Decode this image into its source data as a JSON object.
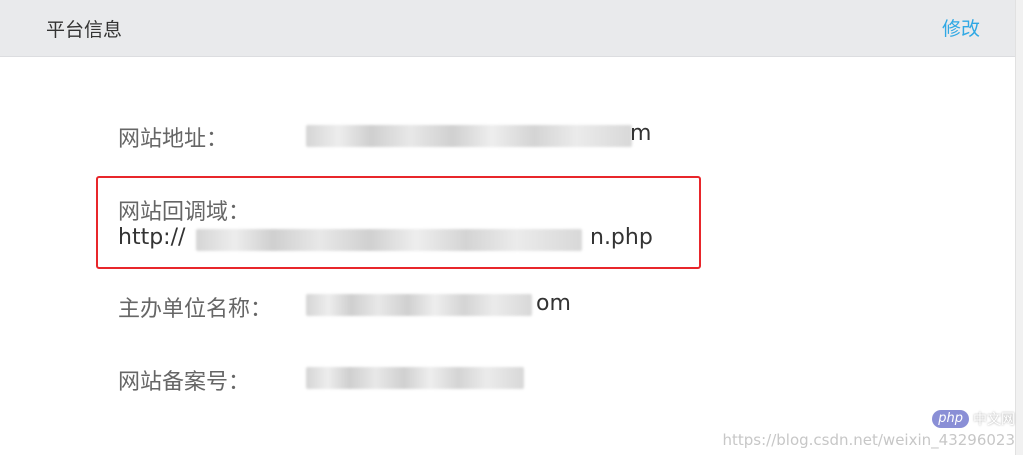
{
  "header": {
    "title": "平台信息",
    "edit_label": "修改"
  },
  "fields": {
    "site_address": {
      "label": "网站地址：",
      "value_suffix": "m"
    },
    "callback_domain": {
      "label": "网站回调域：",
      "value_prefix": "http://",
      "value_suffix": "n.php"
    },
    "organizer": {
      "label": "主办单位名称：",
      "value_suffix": "om"
    },
    "icp": {
      "label": "网站备案号："
    }
  },
  "watermark": {
    "logo": "php",
    "logo_cn": "中文网",
    "url": "https://blog.csdn.net/weixin_43296023"
  }
}
